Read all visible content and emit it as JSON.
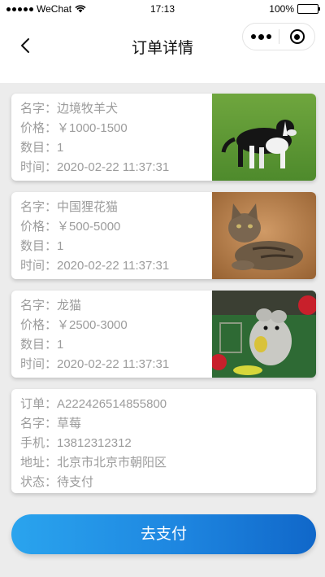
{
  "status_bar": {
    "carrier": "WeChat",
    "time": "17:13",
    "battery": "100%"
  },
  "nav": {
    "title": "订单详情",
    "back_icon": "chevron-left-icon",
    "menu_icon": "more-dots-icon",
    "close_icon": "circle-close-icon"
  },
  "orders": [
    {
      "name": "名字：边境牧羊犬",
      "price": "价格：￥1000-1500",
      "count": "数目：1",
      "time": "时间：2020-02-22 11:37:31",
      "image": "border-collie-photo"
    },
    {
      "name": "名字：中国狸花猫",
      "price": "价格：￥500-5000",
      "count": "数目：1",
      "time": "时间：2020-02-22 11:37:31",
      "image": "tabby-cat-photo"
    },
    {
      "name": "名字：龙猫",
      "price": "价格：￥2500-3000",
      "count": "数目：1",
      "time": "时间：2020-02-22 11:37:31",
      "image": "chinchilla-photo"
    }
  ],
  "summary": {
    "order_no": "订单：A222426514855800",
    "name": "名字：草莓",
    "phone": "手机：13812312312",
    "address": "地址：北京市北京市朝阳区",
    "status": "状态：待支付"
  },
  "pay_button": "去支付",
  "colors": {
    "button_start": "#2aa4ee",
    "button_end": "#1067c9",
    "text_muted": "#9c9c9c",
    "page_bg": "#ececec"
  }
}
